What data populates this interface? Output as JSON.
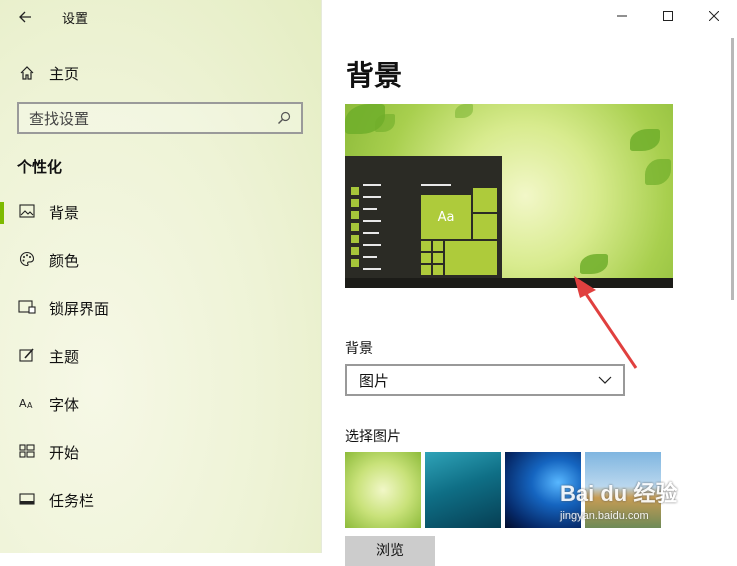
{
  "app": {
    "title": "设置"
  },
  "sidebar": {
    "home_label": "主页",
    "search_placeholder": "查找设置",
    "section_title": "个性化",
    "items": [
      {
        "label": "背景",
        "icon": "image-icon",
        "active": true
      },
      {
        "label": "颜色",
        "icon": "palette-icon",
        "active": false
      },
      {
        "label": "锁屏界面",
        "icon": "lock-screen-icon",
        "active": false
      },
      {
        "label": "主题",
        "icon": "theme-brush-icon",
        "active": false
      },
      {
        "label": "字体",
        "icon": "font-icon",
        "active": false
      },
      {
        "label": "开始",
        "icon": "start-icon",
        "active": false
      },
      {
        "label": "任务栏",
        "icon": "taskbar-icon",
        "active": false
      }
    ]
  },
  "main": {
    "page_title": "背景",
    "preview": {
      "tile_text": "Aa"
    },
    "background_label": "背景",
    "background_value": "图片",
    "choose_label": "选择图片",
    "browse_label": "浏览",
    "thumbnails": [
      "green-leaves",
      "underwater-swimmer",
      "windows-logo",
      "beach-rocks"
    ]
  },
  "watermark": {
    "main": "Bai du 经验",
    "sub": "jingyan.baidu.com"
  },
  "colors": {
    "accent": "#7dba00",
    "sidebar_bg": "#eef3d6",
    "annotation_arrow": "#e0403f"
  }
}
